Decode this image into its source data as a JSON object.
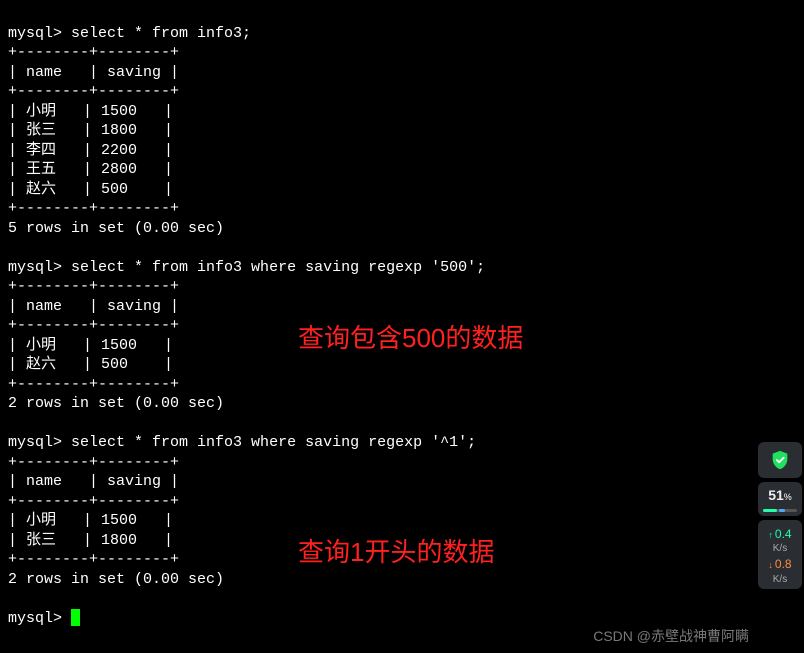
{
  "queries": [
    {
      "prompt": "mysql>",
      "sql": "select * from info3;",
      "sep": "+--------+--------+",
      "header": "| name   | saving |",
      "rows": [
        "| 小明   | 1500   |",
        "| 张三   | 1800   |",
        "| 李四   | 2200   |",
        "| 王五   | 2800   |",
        "| 赵六   | 500    |"
      ],
      "footer": "5 rows in set (0.00 sec)"
    },
    {
      "prompt": "mysql>",
      "sql": "select * from info3 where saving regexp '500';",
      "sep": "+--------+--------+",
      "header": "| name   | saving |",
      "rows": [
        "| 小明   | 1500   |",
        "| 赵六   | 500    |"
      ],
      "footer": "2 rows in set (0.00 sec)"
    },
    {
      "prompt": "mysql>",
      "sql": "select * from info3 where saving regexp '^1';",
      "sep": "+--------+--------+",
      "header": "| name   | saving |",
      "rows": [
        "| 小明   | 1500   |",
        "| 张三   | 1800   |"
      ],
      "footer": "2 rows in set (0.00 sec)"
    }
  ],
  "finalPrompt": "mysql> ",
  "annotations": {
    "a1": "查询包含500的数据",
    "a2": "查询1开头的数据"
  },
  "watermark": "CSDN @赤壁战神曹阿瞒",
  "widget": {
    "percent": "51",
    "percentSuffix": "%",
    "upVal": "0.4",
    "upUnit": "K/s",
    "downVal": "0.8",
    "downUnit": "K/s"
  }
}
